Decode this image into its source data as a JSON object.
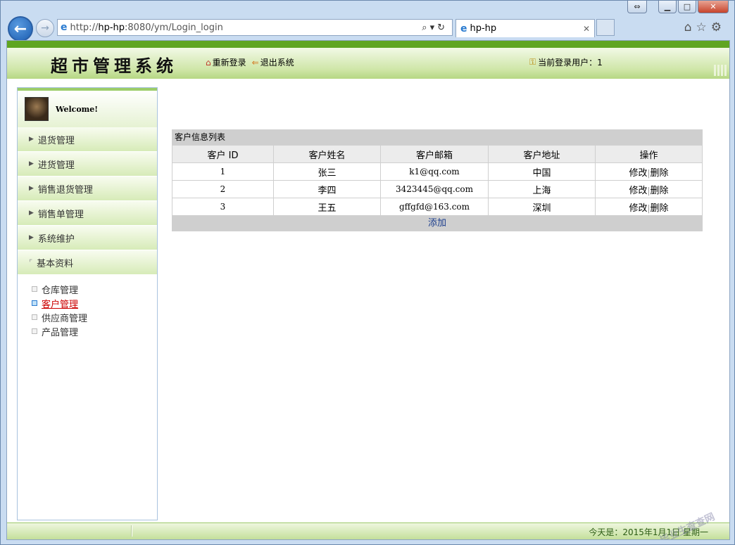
{
  "browser": {
    "url_prefix": "http://",
    "url_host": "hp-hp",
    "url_rest": ":8080/ym/Login_login",
    "tab_title": "hp-hp"
  },
  "header": {
    "system_title": "超市管理系统",
    "relogin": "重新登录",
    "exit": "退出系统",
    "current_user": "当前登录用户：1"
  },
  "sidebar": {
    "welcome": "Welcome!",
    "menu": [
      {
        "label": "退货管理"
      },
      {
        "label": "进货管理"
      },
      {
        "label": "销售退货管理"
      },
      {
        "label": "销售单管理"
      },
      {
        "label": "系统维护"
      },
      {
        "label": "基本资料"
      }
    ],
    "submenu": [
      {
        "label": "仓库管理"
      },
      {
        "label": "客户管理"
      },
      {
        "label": "供应商管理"
      },
      {
        "label": "产品管理"
      }
    ]
  },
  "customers": {
    "title": "客户信息列表",
    "columns": [
      "客户 ID",
      "客户姓名",
      "客户邮箱",
      "客户地址",
      "操作"
    ],
    "rows": [
      {
        "id": "1",
        "name": "张三",
        "email": "k1@qq.com",
        "address": "中国"
      },
      {
        "id": "2",
        "name": "李四",
        "email": "3423445@qq.com",
        "address": "上海"
      },
      {
        "id": "3",
        "name": "王五",
        "email": "gffgfd@163.com",
        "address": "深圳"
      }
    ],
    "edit_label": "修改",
    "delete_label": "删除",
    "add_label": "添加"
  },
  "footer": {
    "date_text": "今天是：2015年1月1日 星期一",
    "watermark": "毕业生查查网"
  }
}
